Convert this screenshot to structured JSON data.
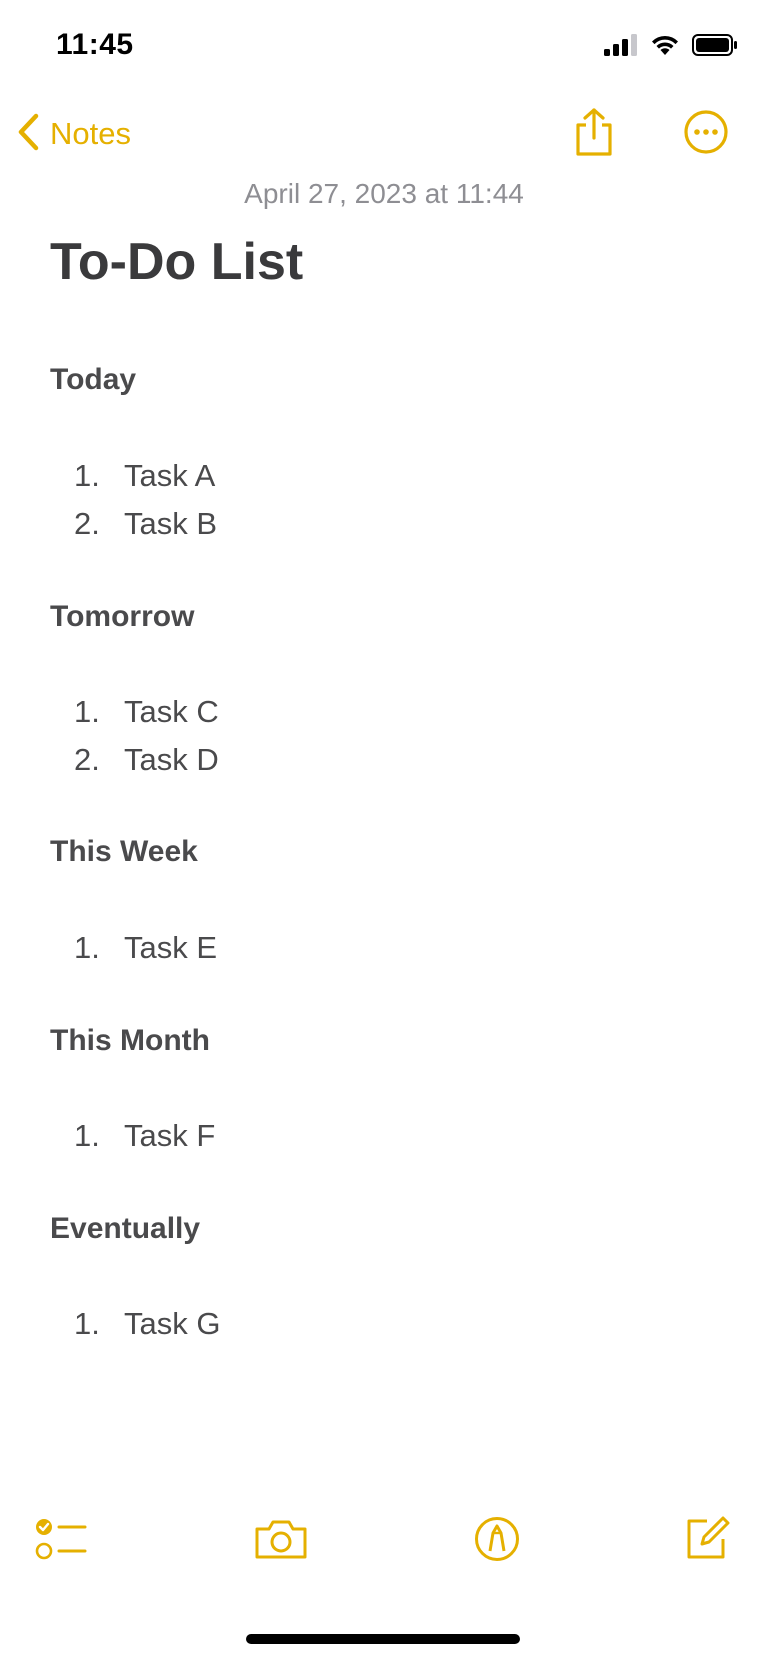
{
  "status_bar": {
    "time": "11:45"
  },
  "nav": {
    "back_label": "Notes",
    "icons": {
      "back": "chevron-left-icon",
      "share": "share-icon",
      "more": "ellipsis-circle-icon"
    }
  },
  "note": {
    "date": "April 27, 2023 at 11:44",
    "title": "To-Do List",
    "sections": [
      {
        "heading": "Today",
        "tasks": [
          {
            "num": "1.",
            "text": "Task A"
          },
          {
            "num": "2.",
            "text": "Task B"
          }
        ]
      },
      {
        "heading": "Tomorrow",
        "tasks": [
          {
            "num": "1.",
            "text": "Task C"
          },
          {
            "num": "2.",
            "text": "Task D"
          }
        ]
      },
      {
        "heading": "This Week",
        "tasks": [
          {
            "num": "1.",
            "text": "Task E"
          }
        ]
      },
      {
        "heading": "This Month",
        "tasks": [
          {
            "num": "1.",
            "text": "Task F"
          }
        ]
      },
      {
        "heading": "Eventually",
        "tasks": [
          {
            "num": "1.",
            "text": "Task G"
          }
        ]
      }
    ]
  },
  "toolbar": {
    "icons": [
      "checklist-icon",
      "camera-icon",
      "markup-pen-icon",
      "compose-icon"
    ]
  },
  "colors": {
    "accent": "#e5b000",
    "text": "#4a4a4c",
    "secondary_text": "#8e8e93"
  }
}
